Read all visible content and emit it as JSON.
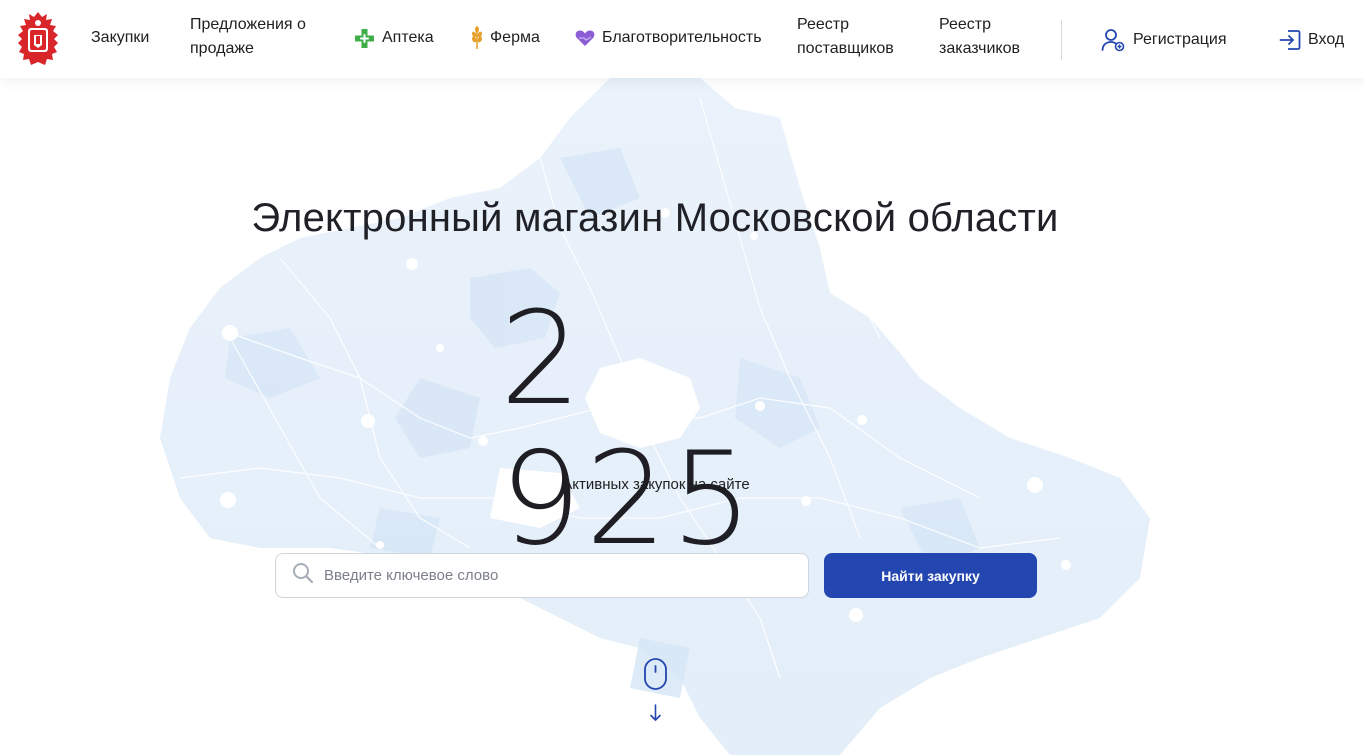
{
  "header": {
    "logo_icon": "moscow-region-coat-of-arms-icon",
    "nav": {
      "purchases": "Закупки",
      "sale_offers_line1": "Предложения о",
      "sale_offers_line2": "продаже",
      "pharmacy": "Аптека",
      "farm": "Ферма",
      "charity": "Благотворительность",
      "suppliers_line1": "Реестр",
      "suppliers_line2": "поставщиков",
      "customers_line1": "Реестр",
      "customers_line2": "заказчиков"
    },
    "registration": "Регистрация",
    "login": "Вход"
  },
  "hero": {
    "title": "Электронный магазин Московской области",
    "counter": "2 925",
    "counter_caption": "Активных закупок на сайте",
    "search_placeholder": "Введите ключевое слово",
    "search_value": "",
    "search_button": "Найти закупку"
  },
  "colors": {
    "accent": "#2346b0",
    "pharmacy_green": "#3fae49",
    "farm_gold": "#e7a12b",
    "charity_purple": "#8a5cd6",
    "logo_red": "#d9262b",
    "map_light": "#e6f0fa"
  }
}
